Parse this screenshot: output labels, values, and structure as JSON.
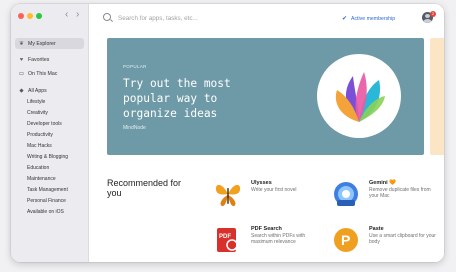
{
  "sidebar": {
    "nav": [
      {
        "label": "My Explorer",
        "icon": "leaf-icon"
      },
      {
        "label": "Favorites",
        "icon": "heart-icon"
      },
      {
        "label": "On This Mac",
        "icon": "laptop-icon"
      },
      {
        "label": "All Apps",
        "icon": "diamond-icon"
      }
    ],
    "categories": [
      "Lifestyle",
      "Creativity",
      "Developer tools",
      "Productivity",
      "Mac Hacks",
      "Writing & Blogging",
      "Education",
      "Maintenance",
      "Task Management",
      "Personal Finance",
      "Available on iOS"
    ]
  },
  "header": {
    "search_placeholder": "Search for apps, tasks, etc...",
    "membership_label": "Active membership",
    "notification_count": "2"
  },
  "hero": {
    "eyebrow": "POPULAR",
    "title": "Try out the most popular way to organize ideas",
    "app_name": "MindNode"
  },
  "recommended": {
    "heading": "Recommended for you",
    "apps": [
      {
        "name": "Ulysses",
        "desc": "Write your first novel"
      },
      {
        "name": "Gemini 🧡",
        "desc": "Remove duplicate files from your Mac"
      },
      {
        "name": "PDF Search",
        "desc": "Search within PDFs with maximum relevance"
      },
      {
        "name": "Paste",
        "desc": "Use a smart clipboard for your body"
      }
    ]
  },
  "colors": {
    "hero_bg": "#6e9aa8",
    "accent": "#2c6bd1",
    "traffic_red": "#fe5f57",
    "traffic_yellow": "#febc2e",
    "traffic_green": "#28c840"
  }
}
